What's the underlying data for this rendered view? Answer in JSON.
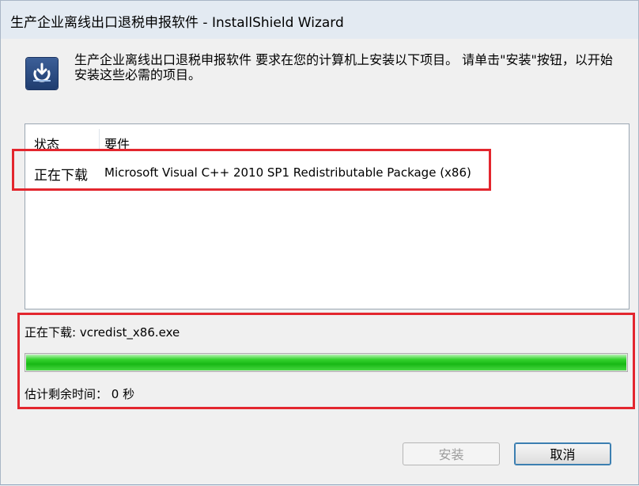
{
  "window": {
    "title": "生产企业离线出口退税申报软件 - InstallShield Wizard"
  },
  "header": {
    "message": "生产企业离线出口退税申报软件 要求在您的计算机上安装以下项目。 请单击\"安装\"按钮，以开始安装这些必需的项目。",
    "icon": "installshield-icon"
  },
  "requirements_list": {
    "columns": [
      "状态",
      "要件"
    ],
    "rows": [
      {
        "status": "正在下载",
        "requirement": "Microsoft Visual C++ 2010 SP1 Redistributable Package (x86)"
      }
    ]
  },
  "download": {
    "label": "正在下载: vcredist_x86.exe",
    "progress_fraction": 1.0,
    "progress_color": "#1fbe1b",
    "eta": "估计剩余时间： 0 秒"
  },
  "buttons": {
    "install": "安装",
    "cancel": "取消"
  },
  "highlight_color": "#e3262e"
}
